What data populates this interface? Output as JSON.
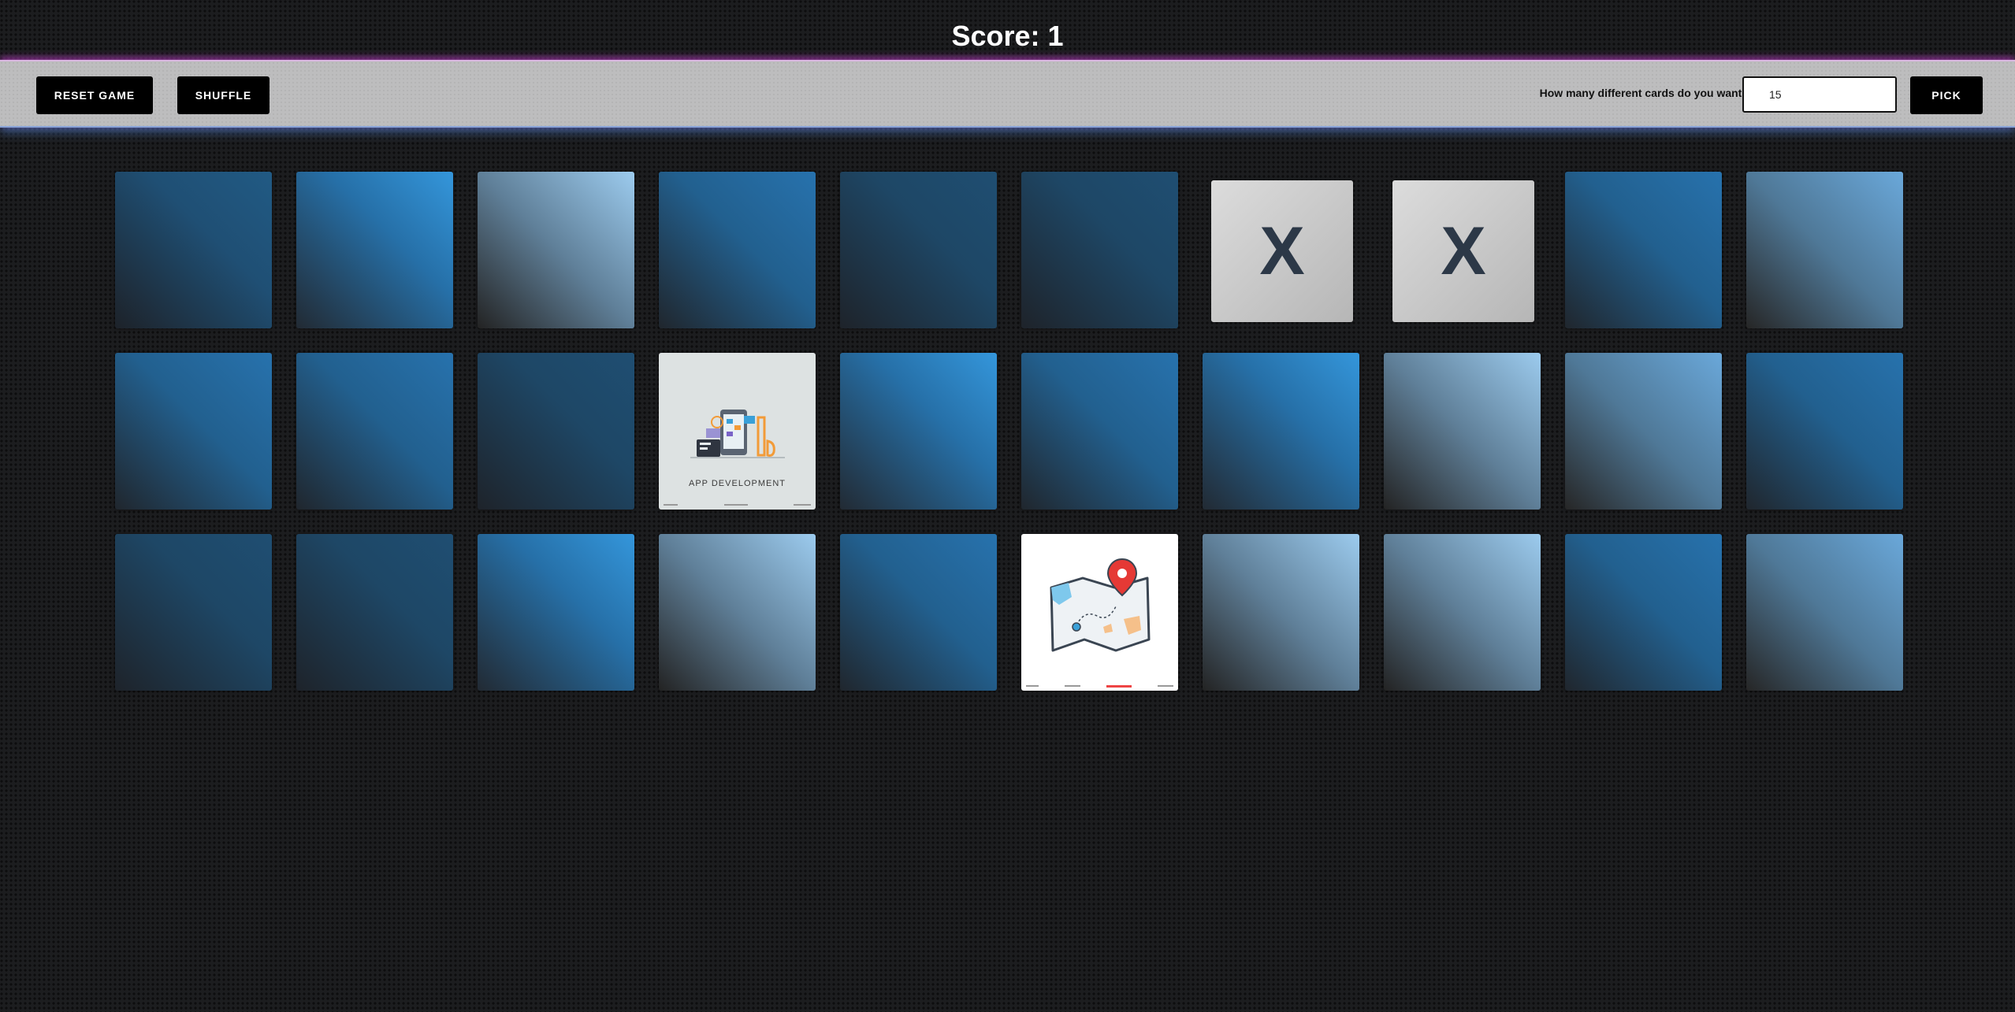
{
  "score": {
    "text": "Score: 1"
  },
  "toolbar": {
    "reset_label": "RESET GAME",
    "shuffle_label": "SHUFFLE",
    "prompt_label": "How many different cards do you want:",
    "card_count_value": "15",
    "pick_label": "PICK"
  },
  "board": {
    "columns": 10,
    "cards": [
      {
        "state": "hidden",
        "shade": 0
      },
      {
        "state": "hidden",
        "shade": 1
      },
      {
        "state": "hidden",
        "shade": 2
      },
      {
        "state": "hidden",
        "shade": 3
      },
      {
        "state": "hidden",
        "shade": 4
      },
      {
        "state": "hidden",
        "shade": 4
      },
      {
        "state": "matched",
        "mark": "X"
      },
      {
        "state": "matched",
        "mark": "X"
      },
      {
        "state": "hidden",
        "shade": 3
      },
      {
        "state": "hidden",
        "shade": 5
      },
      {
        "state": "hidden",
        "shade": 3
      },
      {
        "state": "hidden",
        "shade": 3
      },
      {
        "state": "hidden",
        "shade": 4
      },
      {
        "state": "revealed",
        "face": "app-development",
        "caption": "APP DEVELOPMENT",
        "icon": "app-development-illustration"
      },
      {
        "state": "hidden",
        "shade": 1
      },
      {
        "state": "hidden",
        "shade": 3
      },
      {
        "state": "hidden",
        "shade": 1
      },
      {
        "state": "hidden",
        "shade": 2
      },
      {
        "state": "hidden",
        "shade": 5
      },
      {
        "state": "hidden",
        "shade": 3
      },
      {
        "state": "hidden",
        "shade": 4
      },
      {
        "state": "hidden",
        "shade": 4
      },
      {
        "state": "hidden",
        "shade": 1
      },
      {
        "state": "hidden",
        "shade": 2
      },
      {
        "state": "hidden",
        "shade": 3
      },
      {
        "state": "revealed",
        "face": "map-location",
        "caption": "",
        "icon": "map-pin-illustration"
      },
      {
        "state": "hidden",
        "shade": 2
      },
      {
        "state": "hidden",
        "shade": 2
      },
      {
        "state": "hidden",
        "shade": 3
      },
      {
        "state": "hidden",
        "shade": 5
      }
    ]
  },
  "colors": {
    "background": "#1c1d1f",
    "toolbar": "#bdbdbe",
    "button": "#000000",
    "card_blue": "#3496db",
    "matched_mark": "#2c3847",
    "pin_red": "#e53935"
  }
}
